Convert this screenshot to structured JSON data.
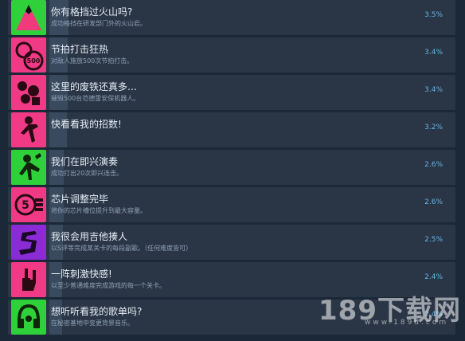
{
  "achievements": [
    {
      "title": "你有格挡过火山吗?",
      "description": "成功格挡在研发部门外的火山岩。",
      "percent": "3.5%",
      "percent_value": 0.035,
      "icon": "volcano-icon",
      "icon_bg": "#2fd13a",
      "icon_symbol": "#f03a7c"
    },
    {
      "title": "节拍打击狂热",
      "description": "对敌人施放500次节拍打击。",
      "percent": "3.4%",
      "percent_value": 0.034,
      "icon": "500-badge-icon",
      "icon_bg": "#f03a86",
      "icon_symbol": "#2a0a12"
    },
    {
      "title": "这里的废铁还真多…",
      "description": "摧毁500台范德雷安保机器人。",
      "percent": "3.4%",
      "percent_value": 0.034,
      "icon": "scrap-robot-icon",
      "icon_bg": "#f03a86",
      "icon_symbol": "#2a0a12"
    },
    {
      "title": "快看看我的招数!",
      "description": "",
      "percent": "3.2%",
      "percent_value": 0.032,
      "icon": "dancing-figure-icon",
      "icon_bg": "#f03a86",
      "icon_symbol": "#2a0a12"
    },
    {
      "title": "我们在即兴演奏",
      "description": "成功打出20次即兴连击。",
      "percent": "2.6%",
      "percent_value": 0.026,
      "icon": "jam-player-icon",
      "icon_bg": "#2fd13a",
      "icon_symbol": "#12240c"
    },
    {
      "title": "芯片调整完毕",
      "description": "将你的芯片槽位提升到最大容量。",
      "percent": "2.6%",
      "percent_value": 0.026,
      "icon": "chip-5-icon",
      "icon_bg": "#f03a86",
      "icon_symbol": "#2a0a12"
    },
    {
      "title": "我很会用吉他揍人",
      "description": "以S评等完成某关卡的每段副歌。（任何难度皆可）",
      "percent": "2.5%",
      "percent_value": 0.025,
      "icon": "s-rank-icon",
      "icon_bg": "#8b2bd6",
      "icon_symbol": "#1a0826"
    },
    {
      "title": "一阵刺激快感!",
      "description": "以至少普通难度完成游戏的每一个关卡。",
      "percent": "2.4%",
      "percent_value": 0.024,
      "icon": "hand-rock-icon",
      "icon_bg": "#f03a86",
      "icon_symbol": "#2a0a12"
    },
    {
      "title": "想听听看我的歌单吗?",
      "description": "在秘密基地中变更背景音乐。",
      "percent": "2.4%",
      "percent_value": 0.024,
      "icon": "headphones-icon",
      "icon_bg": "#2fd13a",
      "icon_symbol": "#12240c"
    }
  ],
  "watermark": {
    "main": "189下载网",
    "sub": "www.189d.com"
  }
}
